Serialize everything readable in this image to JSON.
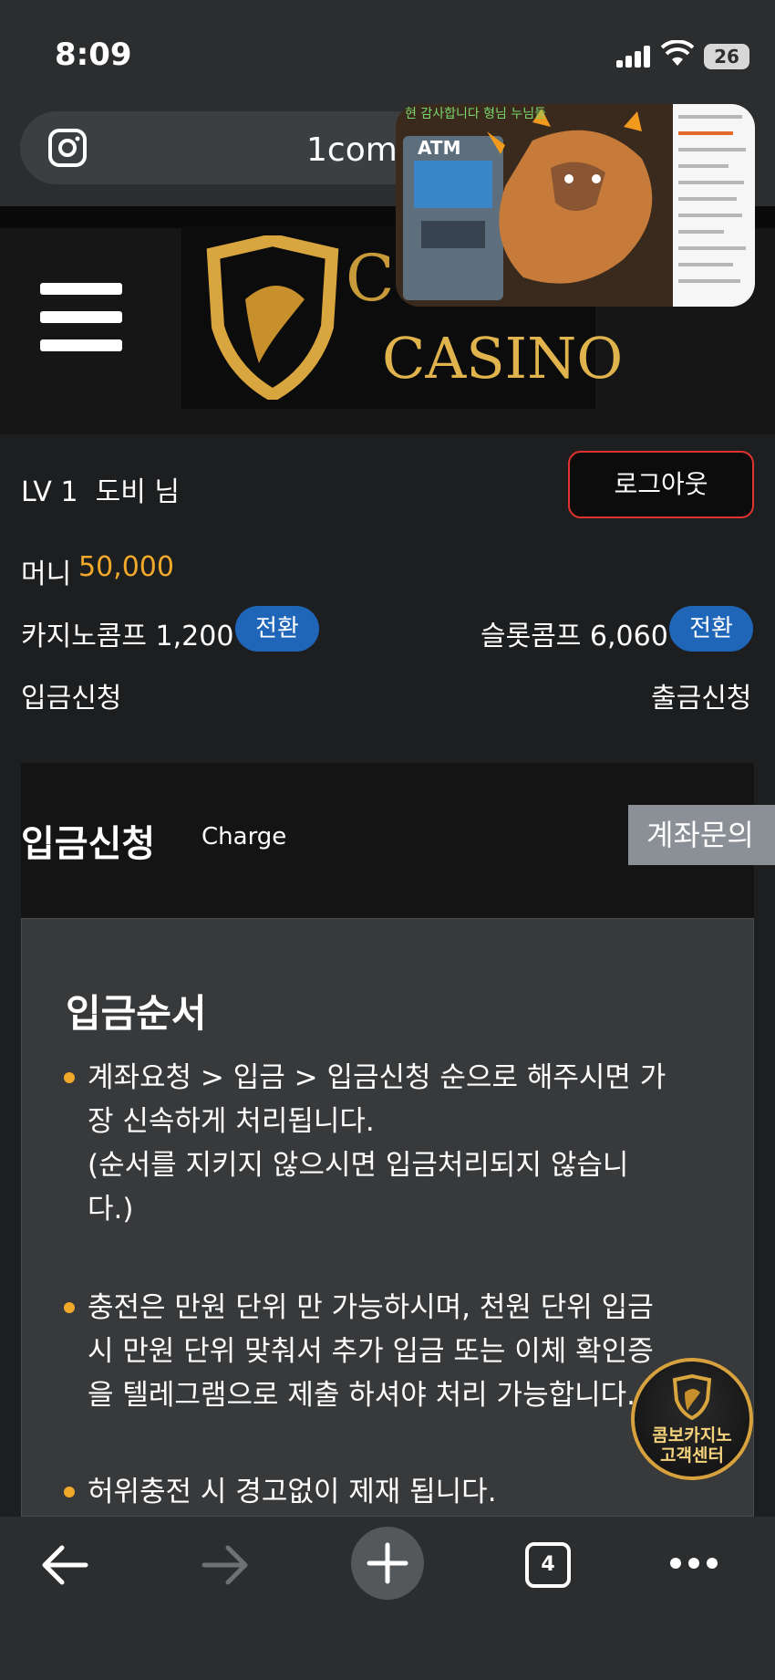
{
  "status_bar": {
    "time": "8:09",
    "battery": "26"
  },
  "browser": {
    "url": "1comb",
    "tab_count": "4"
  },
  "pip_overlay": {
    "caption": "현 감사합니다 형님 누님들",
    "atm_label": "ATM"
  },
  "logo": {
    "line1": "COMBO",
    "line2": "CASINO"
  },
  "user": {
    "level": "LV 1",
    "name": "도비 님",
    "logout_label": "로그아웃",
    "money_label": "머니",
    "money_value": "50,000",
    "casino_comp": "카지노콤프 1,200",
    "slot_comp": "슬롯콤프 6,060",
    "convert_label": "전환",
    "deposit_link": "입금신청",
    "withdraw_link": "출금신청"
  },
  "panel": {
    "title": "입금신청",
    "subtitle": "Charge",
    "account_inquiry": "계좌문의",
    "order_title": "입금순서",
    "bullets": [
      {
        "line1": "계좌요청 > 입금 > 입금신청 순으로 해주시면 가",
        "line2": "장 신속하게 처리됩니다.",
        "line3": "(순서를 지키지 않으시면 입금처리되지 않습니",
        "line4": "다.)"
      },
      {
        "line1": "충전은 만원 단위 만 가능하시며, 천원 단위 입금",
        "line2": "시 만원 단위 맞춰서 추가 입금 또는 이체 확인증",
        "line3": "을 텔레그램으로 제출 하셔야 처리 가능합니다."
      },
      {
        "line1": "허위충전 시 경고없이 제재 됩니다."
      }
    ]
  },
  "support_badge": {
    "line1": "콤보카지노",
    "line2": "고객센터"
  },
  "colors": {
    "accent_gold": "#f0a92b",
    "convert_blue": "#1f66b8",
    "logout_border": "#e0332f"
  }
}
